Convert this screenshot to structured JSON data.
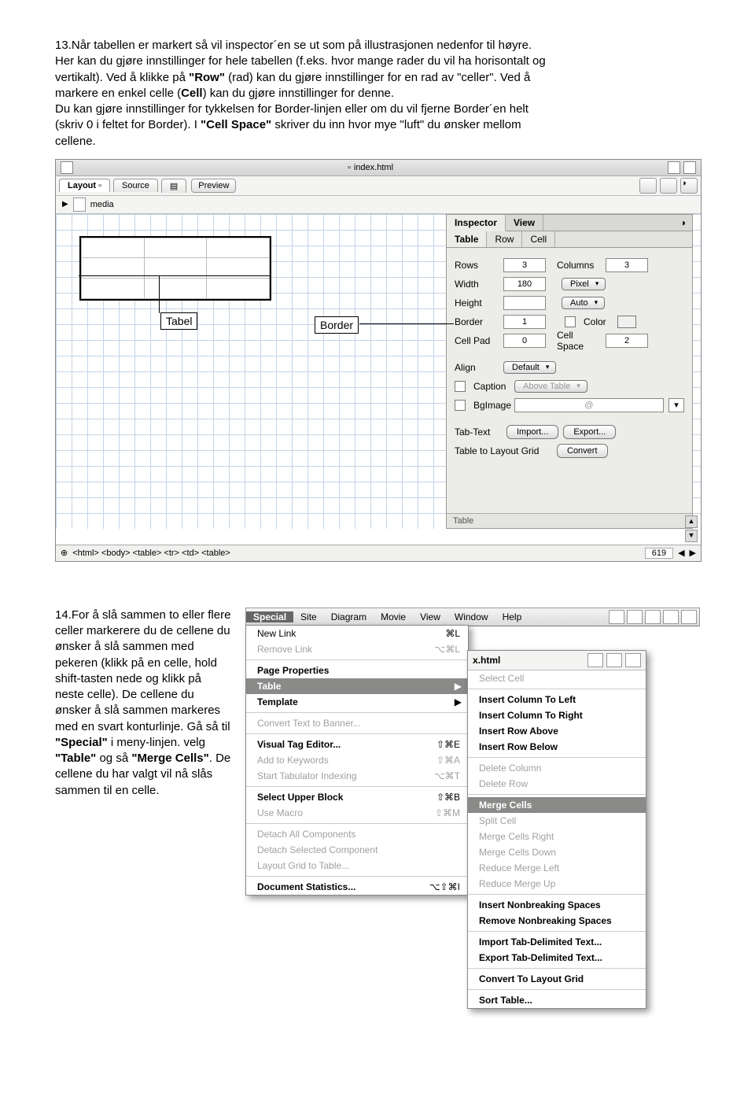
{
  "p13": {
    "num": "13.",
    "l1": "Når tabellen er markert så vil inspector´en se ut som på illustrasjonen nedenfor til høyre.",
    "l2a": "Her kan du gjøre innstillinger for hele tabellen (f.eks. hvor mange rader du vil ha horisontalt og",
    "l3a": "vertikalt). Ved å klikke på ",
    "l3b": "\"Row\"",
    "l3c": " (rad) kan du gjøre innstillinger for en rad av \"celler\". Ved å",
    "l4a": "markere en enkel celle (",
    "l4b": "Cell",
    "l4c": ") kan du gjøre innstillinger for denne.",
    "l5": "Du kan gjøre innstillinger for tykkelsen for Border-linjen eller om du vil fjerne Border´en helt",
    "l6a": "(skriv 0 i feltet for Border). I ",
    "l6b": "\"Cell Space\"",
    "l6c": " skriver du inn hvor mye \"luft\" du ønsker mellom",
    "l7": "cellene."
  },
  "annotations": {
    "tabel": "Tabel",
    "border": "Border"
  },
  "docwin": {
    "title": "index.html",
    "mode_layout": "Layout",
    "mode_source": "Source",
    "mode_preview": "Preview",
    "media": "media",
    "breadcrumb": "<html> <body> <table> <tr> <td> <table>",
    "zoom": "619"
  },
  "inspector": {
    "tab_inspector": "Inspector",
    "tab_view": "View",
    "tab_table": "Table",
    "tab_row": "Row",
    "tab_cell": "Cell",
    "rows_lbl": "Rows",
    "rows_val": "3",
    "columns_lbl": "Columns",
    "columns_val": "3",
    "width_lbl": "Width",
    "width_val": "180",
    "width_unit": "Pixel",
    "height_lbl": "Height",
    "height_unit": "Auto",
    "border_lbl": "Border",
    "border_val": "1",
    "color_lbl": "Color",
    "cellpad_lbl": "Cell Pad",
    "cellpad_val": "0",
    "cellspace_lbl": "Cell Space",
    "cellspace_val": "2",
    "align_lbl": "Align",
    "align_val": "Default",
    "caption_lbl": "Caption",
    "caption_val": "Above Table",
    "bgimage_lbl": "BgImage",
    "tabtext_lbl": "Tab-Text",
    "import_btn": "Import...",
    "export_btn": "Export...",
    "layout_lbl": "Table to Layout Grid",
    "convert_btn": "Convert",
    "footer": "Table"
  },
  "p14": {
    "num": "14.",
    "body": "For å slå sammen to eller flere celler markerere du de cellene du ønsker å slå sammen med pekeren (klikk på en celle, hold shift-tasten nede og klikk på neste celle). De cellene du ønsker å slå sammen markeres med en svart konturlinje. Gå så til ",
    "b1": "\"Special\"",
    "c1": " i meny-linjen. velg ",
    "b2": "\"Table\"",
    "c2": " og så ",
    "b3": "\"Merge Cells\"",
    "c3": ". De cellene du har valgt vil nå slås sammen til en celle."
  },
  "menubar": {
    "special": "Special",
    "site": "Site",
    "diagram": "Diagram",
    "movie": "Movie",
    "view": "View",
    "window": "Window",
    "help": "Help",
    "subtitle": "x.html"
  },
  "mainmenu": {
    "new_link": "New Link",
    "new_link_s": "⌘L",
    "remove_link": "Remove Link",
    "remove_link_s": "⌥⌘L",
    "page_props": "Page Properties",
    "table": "Table",
    "template": "Template",
    "convert_banner": "Convert Text to Banner...",
    "vte": "Visual Tag Editor...",
    "vte_s": "⇧⌘E",
    "add_kw": "Add to Keywords",
    "add_kw_s": "⇧⌘A",
    "start_tab": "Start Tabulator Indexing",
    "start_tab_s": "⌥⌘T",
    "sel_upper": "Select Upper Block",
    "sel_upper_s": "⇧⌘B",
    "use_macro": "Use Macro",
    "use_macro_s": "⇧⌘M",
    "detach_all": "Detach All Components",
    "detach_sel": "Detach Selected Component",
    "lg_to_table": "Layout Grid to Table...",
    "doc_stats": "Document Statistics...",
    "doc_stats_s": "⌥⇧⌘I"
  },
  "submenu": {
    "select_cell": "Select Cell",
    "ins_col_left": "Insert Column To Left",
    "ins_col_right": "Insert Column To Right",
    "ins_row_above": "Insert Row Above",
    "ins_row_below": "Insert Row Below",
    "del_col": "Delete Column",
    "del_row": "Delete Row",
    "merge": "Merge Cells",
    "split": "Split Cell",
    "merge_r": "Merge Cells Right",
    "merge_d": "Merge Cells Down",
    "red_l": "Reduce Merge Left",
    "red_u": "Reduce Merge Up",
    "ins_nb": "Insert Nonbreaking Spaces",
    "rem_nb": "Remove Nonbreaking Spaces",
    "imp_tab": "Import Tab-Delimited Text...",
    "exp_tab": "Export Tab-Delimited Text...",
    "conv_lg": "Convert To Layout Grid",
    "sort": "Sort Table..."
  }
}
